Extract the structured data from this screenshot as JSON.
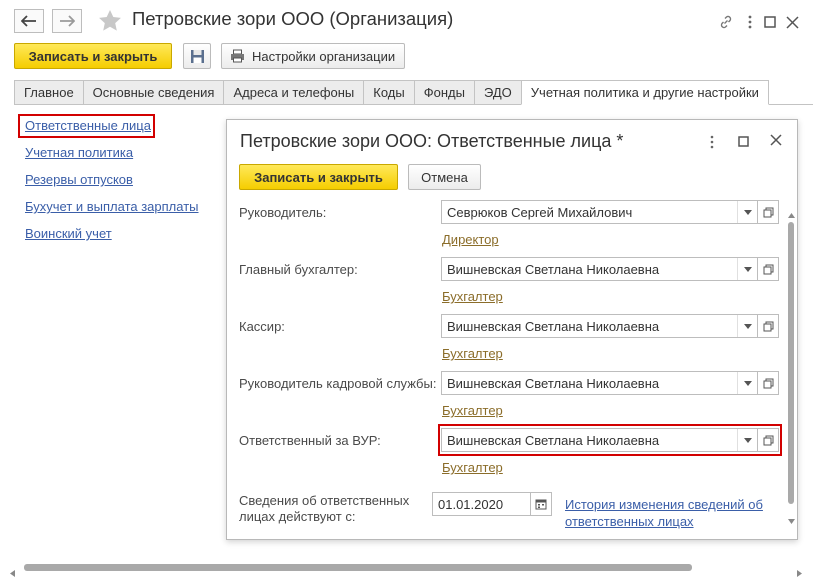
{
  "window": {
    "title": "Петровские зори ООО (Организация)",
    "back_icon": "arrow-left-icon",
    "forward_icon": "arrow-right-icon",
    "favorite_icon": "star-icon",
    "link_icon": "link-icon",
    "menu_icon": "more-vertical-icon",
    "maximize_icon": "maximize-icon",
    "close_icon": "close-icon"
  },
  "toolbar": {
    "save_close_label": "Записать и закрыть",
    "save_icon": "floppy-disk-icon",
    "org_settings_label": "Настройки организации",
    "print_icon": "printer-icon"
  },
  "tabs": [
    {
      "label": "Главное"
    },
    {
      "label": "Основные сведения"
    },
    {
      "label": "Адреса и телефоны"
    },
    {
      "label": "Коды"
    },
    {
      "label": "Фонды"
    },
    {
      "label": "ЭДО"
    },
    {
      "label": "Учетная политика и другие настройки",
      "active": true
    }
  ],
  "left_links": [
    {
      "label": "Ответственные лица",
      "highlighted": true
    },
    {
      "label": "Учетная политика"
    },
    {
      "label": "Резервы отпусков"
    },
    {
      "label": "Бухучет и выплата зарплаты"
    },
    {
      "label": "Воинский учет"
    }
  ],
  "dialog": {
    "title": "Петровские зори ООО: Ответственные лица *",
    "save_close_label": "Записать и закрыть",
    "cancel_label": "Отмена",
    "fields": [
      {
        "label": "Руководитель:",
        "value": "Севрюков Сергей Михайлович",
        "position": "Директор"
      },
      {
        "label": "Главный бухгалтер:",
        "value": "Вишневская Светлана Николаевна",
        "position": "Бухгалтер"
      },
      {
        "label": "Кассир:",
        "value": "Вишневская Светлана Николаевна",
        "position": "Бухгалтер"
      },
      {
        "label": "Руководитель кадровой службы:",
        "value": "Вишневская Светлана Николаевна",
        "position": "Бухгалтер"
      },
      {
        "label": "Ответственный за ВУР:",
        "value": "Вишневская Светлана Николаевна",
        "position": "Бухгалтер",
        "highlighted": true
      }
    ],
    "effective": {
      "label_line1": "Сведения об ответственных",
      "label_line2": "лицах действуют с:",
      "date": "01.01.2020",
      "calendar_icon": "calendar-icon",
      "history_line1": "История изменения сведений об",
      "history_line2": "ответственных лицах"
    }
  },
  "colors": {
    "accent_yellow": "#f5cd00",
    "highlight_red": "#d20000",
    "link_blue": "#3a5ea8",
    "sublink_brown": "#8b6d2a"
  }
}
